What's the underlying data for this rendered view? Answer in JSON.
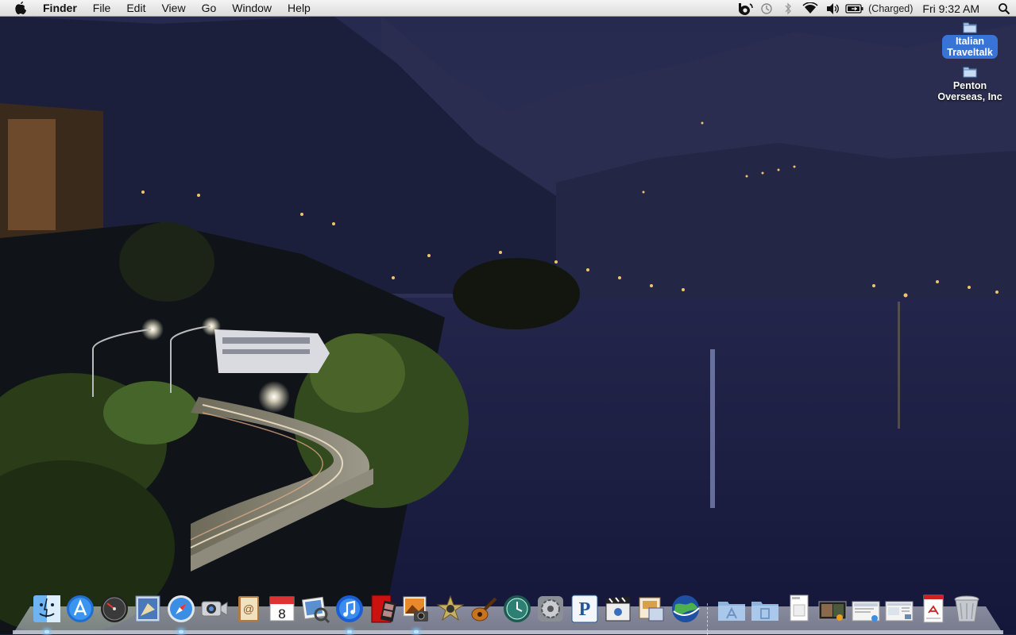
{
  "menubar": {
    "app_name": "Finder",
    "menus": [
      "File",
      "Edit",
      "View",
      "Go",
      "Window",
      "Help"
    ],
    "status": {
      "battery_text": "(Charged)",
      "clock": "Fri 9:32 AM"
    }
  },
  "desktop": {
    "items": [
      {
        "label_line1": "Italian",
        "label_line2": "Traveltalk",
        "selected": true
      },
      {
        "label_line1": "Penton",
        "label_line2": "Overseas, Inc",
        "selected": false
      }
    ]
  },
  "dock": {
    "apps": [
      {
        "icon": "finder-icon",
        "running": true
      },
      {
        "icon": "app-store-icon",
        "running": false
      },
      {
        "icon": "dashboard-icon",
        "running": false
      },
      {
        "icon": "mail-icon",
        "running": false
      },
      {
        "icon": "safari-icon",
        "running": true
      },
      {
        "icon": "facetime-icon",
        "running": false
      },
      {
        "icon": "address-book-icon",
        "running": false
      },
      {
        "icon": "ical-icon",
        "running": false,
        "text": "8"
      },
      {
        "icon": "preview-icon",
        "running": false
      },
      {
        "icon": "itunes-icon",
        "running": true
      },
      {
        "icon": "photo-booth-icon",
        "running": false
      },
      {
        "icon": "iphoto-icon",
        "running": true
      },
      {
        "icon": "imovie-icon",
        "running": false
      },
      {
        "icon": "garageband-icon",
        "running": false
      },
      {
        "icon": "time-machine-icon",
        "running": false
      },
      {
        "icon": "system-preferences-icon",
        "running": false
      },
      {
        "icon": "pandora-icon",
        "running": false,
        "text": "P"
      },
      {
        "icon": "final-cut-icon",
        "running": false
      },
      {
        "icon": "iwork-icon",
        "running": false
      },
      {
        "icon": "google-earth-icon",
        "running": false
      }
    ],
    "docs": [
      {
        "icon": "applications-folder-icon"
      },
      {
        "icon": "documents-folder-icon"
      },
      {
        "icon": "document-stack-icon"
      },
      {
        "icon": "photo-stack-icon"
      },
      {
        "icon": "screenshot-stack-icon"
      },
      {
        "icon": "window-stack-icon"
      },
      {
        "icon": "pdf-document-icon"
      },
      {
        "icon": "trash-icon"
      }
    ]
  }
}
